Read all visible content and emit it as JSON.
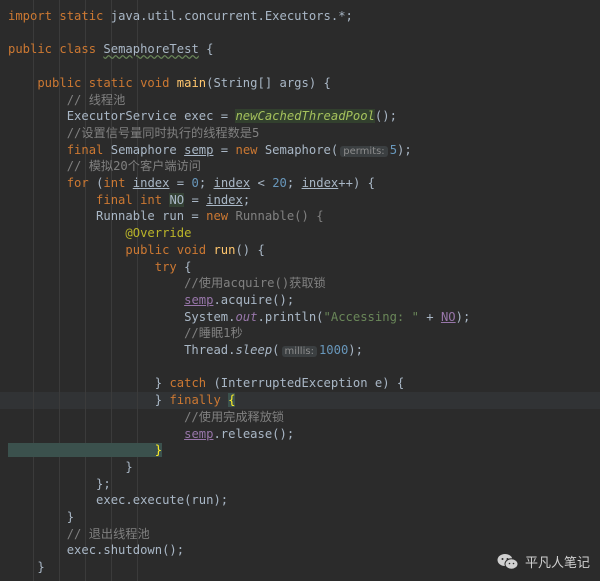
{
  "colors": {
    "background": "#2b2b2b",
    "keyword": "#cc7832",
    "text": "#a9b7c6",
    "comment": "#808080",
    "number": "#6897bb",
    "string": "#6a8759",
    "annotation": "#bbb529",
    "method": "#ffc66d",
    "static_field": "#9876aa",
    "hint": "#8c8c8c"
  },
  "code_lines": [
    [
      {
        "t": "import static ",
        "c": "keyword"
      },
      {
        "t": "java.util.concurrent.Executors.*;",
        "c": "text"
      }
    ],
    [],
    [
      {
        "t": "public class ",
        "c": "keyword"
      },
      {
        "t": "SemaphoreTest",
        "c": "text",
        "u": "wavy"
      },
      {
        "t": " {",
        "c": "text"
      }
    ],
    [],
    [
      {
        "t": "    public static void ",
        "c": "keyword"
      },
      {
        "t": "main",
        "c": "method"
      },
      {
        "t": "(String[] args) {",
        "c": "text"
      }
    ],
    [
      {
        "t": "        // 线程池",
        "c": "comment"
      }
    ],
    [
      {
        "t": "        ExecutorService exec = ",
        "c": "text"
      },
      {
        "t": "newCachedThreadPool",
        "c": "italic_green"
      },
      {
        "t": "();",
        "c": "text"
      }
    ],
    [
      {
        "t": "        //设置信号量同时执行的线程数是5",
        "c": "comment"
      }
    ],
    [
      {
        "t": "        final ",
        "c": "keyword"
      },
      {
        "t": "Semaphore ",
        "c": "text"
      },
      {
        "t": "semp",
        "c": "text",
        "u": "line"
      },
      {
        "t": " = ",
        "c": "text"
      },
      {
        "t": "new ",
        "c": "keyword"
      },
      {
        "t": "Semaphore(",
        "c": "text"
      },
      {
        "h": "permits:"
      },
      {
        "t": "5",
        "c": "number"
      },
      {
        "t": ");",
        "c": "text"
      }
    ],
    [
      {
        "t": "        // 模拟20个客户端访问",
        "c": "comment"
      }
    ],
    [
      {
        "t": "        for ",
        "c": "keyword"
      },
      {
        "t": "(",
        "c": "text"
      },
      {
        "t": "int ",
        "c": "keyword"
      },
      {
        "t": "index",
        "c": "text",
        "u": "line"
      },
      {
        "t": " = ",
        "c": "text"
      },
      {
        "t": "0",
        "c": "number"
      },
      {
        "t": "; ",
        "c": "text"
      },
      {
        "t": "index",
        "c": "text",
        "u": "line"
      },
      {
        "t": " < ",
        "c": "text"
      },
      {
        "t": "20",
        "c": "number"
      },
      {
        "t": "; ",
        "c": "text"
      },
      {
        "t": "index",
        "c": "text",
        "u": "line"
      },
      {
        "t": "++) {",
        "c": "text"
      }
    ],
    [
      {
        "t": "            final int ",
        "c": "keyword"
      },
      {
        "t": "NO",
        "c": "text",
        "bg": "#344134"
      },
      {
        "t": " = ",
        "c": "text"
      },
      {
        "t": "index",
        "c": "text",
        "u": "line"
      },
      {
        "t": ";",
        "c": "text"
      }
    ],
    [
      {
        "t": "            Runnable run = ",
        "c": "text"
      },
      {
        "t": "new ",
        "c": "keyword"
      },
      {
        "t": "Runnable() {",
        "c": "comment"
      }
    ],
    [
      {
        "t": "                @Override",
        "c": "annotation"
      }
    ],
    [
      {
        "t": "                public void ",
        "c": "keyword"
      },
      {
        "t": "run",
        "c": "method"
      },
      {
        "t": "() {",
        "c": "text"
      }
    ],
    [
      {
        "t": "                    try ",
        "c": "keyword"
      },
      {
        "t": "{",
        "c": "text"
      }
    ],
    [
      {
        "t": "                        //使用acquire()获取锁",
        "c": "comment"
      }
    ],
    [
      {
        "t": "                        ",
        "c": "text"
      },
      {
        "t": "semp",
        "c": "static_field",
        "u": "line"
      },
      {
        "t": ".acquire();",
        "c": "text"
      }
    ],
    [
      {
        "t": "                        System.",
        "c": "text"
      },
      {
        "t": "out",
        "c": "static_italic"
      },
      {
        "t": ".println(",
        "c": "text"
      },
      {
        "t": "\"Accessing: \"",
        "c": "string"
      },
      {
        "t": " + ",
        "c": "text"
      },
      {
        "t": "NO",
        "c": "static_field",
        "u": "line"
      },
      {
        "t": ");",
        "c": "text"
      }
    ],
    [
      {
        "t": "                        //睡眠1秒",
        "c": "comment"
      }
    ],
    [
      {
        "t": "                        Thread.",
        "c": "text"
      },
      {
        "t": "sleep",
        "c": "italic_text"
      },
      {
        "t": "(",
        "c": "text"
      },
      {
        "h": "millis:"
      },
      {
        "t": "1000",
        "c": "number"
      },
      {
        "t": ");",
        "c": "text"
      }
    ],
    [],
    [
      {
        "t": "                    } ",
        "c": "text"
      },
      {
        "t": "catch ",
        "c": "keyword"
      },
      {
        "t": "(InterruptedException e) {",
        "c": "text"
      }
    ],
    [
      {
        "t": "                    } ",
        "c": "text"
      },
      {
        "t": "finally ",
        "c": "keyword"
      },
      {
        "t": "{",
        "c": "brace_hl"
      }
    ],
    [
      {
        "t": "                        //使用完成释放锁",
        "c": "comment"
      }
    ],
    [
      {
        "t": "                        ",
        "c": "text"
      },
      {
        "t": "semp",
        "c": "static_field",
        "u": "line"
      },
      {
        "t": ".release();",
        "c": "text"
      }
    ],
    [
      {
        "t": "                    }",
        "c": "brace_hl"
      }
    ],
    [
      {
        "t": "                }",
        "c": "text"
      }
    ],
    [
      {
        "t": "            };",
        "c": "text"
      }
    ],
    [
      {
        "t": "            exec.execute(run);",
        "c": "text"
      }
    ],
    [
      {
        "t": "        }",
        "c": "text"
      }
    ],
    [
      {
        "t": "        // 退出线程池",
        "c": "comment"
      }
    ],
    [
      {
        "t": "        exec.shutdown();",
        "c": "text"
      }
    ],
    [
      {
        "t": "    }",
        "c": "text"
      }
    ]
  ],
  "watermark": {
    "icon": "wechat-icon",
    "text": "平凡人笔记"
  }
}
